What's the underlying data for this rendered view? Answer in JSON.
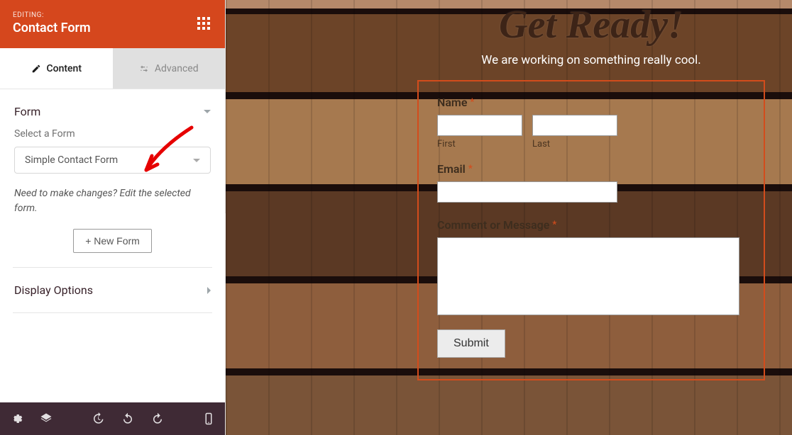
{
  "sidebar": {
    "editing_label": "EDITING:",
    "title": "Contact Form",
    "tabs": {
      "content": "Content",
      "advanced": "Advanced"
    },
    "form_section": "Form",
    "select_label": "Select a Form",
    "select_value": "Simple Contact Form",
    "help_text": "Need to make changes? Edit the selected form.",
    "new_form": "+ New Form",
    "display_options": "Display Options"
  },
  "preview": {
    "headline": "Get Ready!",
    "tagline": "We are working on something really cool.",
    "name_label": "Name",
    "first_label": "First",
    "last_label": "Last",
    "email_label": "Email",
    "comment_label": "Comment or Message",
    "submit": "Submit",
    "required_mark": "*"
  }
}
